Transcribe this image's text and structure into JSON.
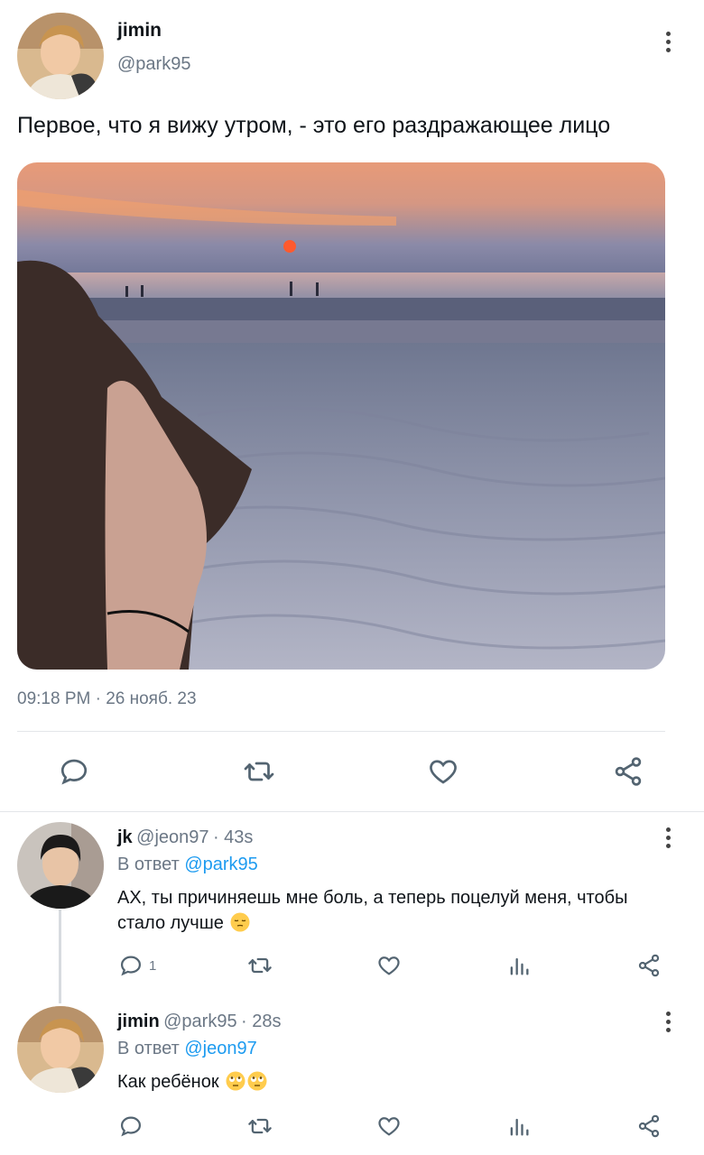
{
  "main_tweet": {
    "author_name": "jimin",
    "author_handle": "@park95",
    "text": "Первое, что я вижу утром, - это его раздражающее лицо",
    "timestamp": "09:18 PM · 26 нояб. 23"
  },
  "replies": [
    {
      "author_name": "jk",
      "author_handle": "@jeon97",
      "time": "· 43s",
      "reply_prefix": "В ответ",
      "reply_to": "@park95",
      "text_line1": "АХ, ты причиняешь мне боль, а теперь поцелуй меня, чтобы",
      "text_line2": "стало лучше",
      "emoji": "pensive-face",
      "reply_count": "1"
    },
    {
      "author_name": "jimin",
      "author_handle": "@park95",
      "time": "· 28s",
      "reply_prefix": "В ответ",
      "reply_to": "@jeon97",
      "text": "Как ребёнок",
      "emoji": "face-with-rolling-eyes x2",
      "reply_count": ""
    }
  ],
  "icons": {
    "reply": "speech-bubble-icon",
    "retweet": "retweet-icon",
    "like": "heart-icon",
    "share": "share-icon",
    "views": "bar-chart-icon",
    "more": "vertical-ellipsis-icon"
  },
  "colors": {
    "text_primary": "#0f1419",
    "text_secondary": "#6b7785",
    "link": "#1d9bf0",
    "icon": "#536471",
    "divider": "#e3e6e9"
  }
}
